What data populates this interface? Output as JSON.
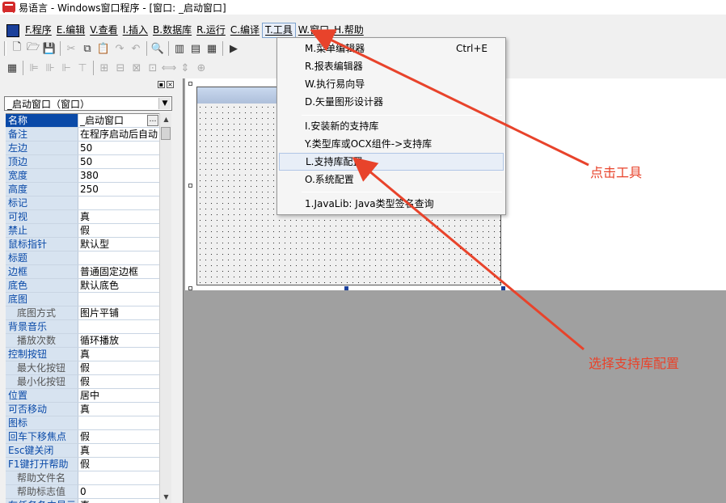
{
  "window": {
    "title": "易语言 - Windows窗口程序 - [窗口: _启动窗口]"
  },
  "menubar": {
    "items": [
      "F.程序",
      "E.编辑",
      "V.查看",
      "I.插入",
      "B.数据库",
      "R.运行",
      "C.编译",
      "T.工具",
      "W.窗口",
      "H.帮助"
    ]
  },
  "toolbar1": {
    "icons": [
      "new-icon",
      "open-icon",
      "save-icon",
      "cut-icon",
      "copy-icon",
      "paste-icon",
      "redo-icon",
      "undo-icon",
      "find-icon",
      "layout1-icon",
      "layout2-icon",
      "layout3-icon",
      "run-icon"
    ]
  },
  "toolbar2": {
    "icons": [
      "grid-icon",
      "align-left-icon",
      "align-center-icon",
      "align-right-icon",
      "align-top-icon",
      "align-middle-icon",
      "align-bottom-icon",
      "same-width-icon",
      "same-height-icon",
      "space-h-icon",
      "space-v-icon",
      "center-h-icon"
    ]
  },
  "object_selector": {
    "value": "_启动窗口（窗口）"
  },
  "properties": [
    {
      "name": "名称",
      "value": "_启动窗口",
      "selected": true
    },
    {
      "name": "备注",
      "value": "在程序启动后自动"
    },
    {
      "name": "左边",
      "value": "50"
    },
    {
      "name": "顶边",
      "value": "50"
    },
    {
      "name": "宽度",
      "value": "380"
    },
    {
      "name": "高度",
      "value": "250"
    },
    {
      "name": "标记",
      "value": ""
    },
    {
      "name": "可视",
      "value": "真"
    },
    {
      "name": "禁止",
      "value": "假"
    },
    {
      "name": "鼠标指针",
      "value": "默认型"
    },
    {
      "name": "标题",
      "value": ""
    },
    {
      "name": "边框",
      "value": "普通固定边框"
    },
    {
      "name": "底色",
      "value": "默认底色"
    },
    {
      "name": "底图",
      "value": ""
    },
    {
      "name": "底图方式",
      "value": "图片平铺",
      "sub": true
    },
    {
      "name": "背景音乐",
      "value": ""
    },
    {
      "name": "播放次数",
      "value": "循环播放",
      "sub": true
    },
    {
      "name": "控制按钮",
      "value": "真"
    },
    {
      "name": "最大化按钮",
      "value": "假",
      "sub": true
    },
    {
      "name": "最小化按钮",
      "value": "假",
      "sub": true
    },
    {
      "name": "位置",
      "value": "居中"
    },
    {
      "name": "可否移动",
      "value": "真"
    },
    {
      "name": "图标",
      "value": ""
    },
    {
      "name": "回车下移焦点",
      "value": "假"
    },
    {
      "name": "Esc键关闭",
      "value": "真"
    },
    {
      "name": "F1键打开帮助",
      "value": "假"
    },
    {
      "name": "帮助文件名",
      "value": "",
      "sub": true
    },
    {
      "name": "帮助标志值",
      "value": "0",
      "sub": true
    },
    {
      "name": "在任务条中显示",
      "value": "真"
    }
  ],
  "tools_menu": {
    "items": [
      {
        "label": "M.菜单编辑器",
        "shortcut": "Ctrl+E"
      },
      {
        "label": "R.报表编辑器",
        "shortcut": ""
      },
      {
        "label": "W.执行易向导",
        "shortcut": ""
      },
      {
        "label": "D.矢量图形设计器",
        "shortcut": ""
      },
      {
        "label": "I.安装新的支持库",
        "shortcut": ""
      },
      {
        "label": "Y.类型库或OCX组件->支持库",
        "shortcut": ""
      },
      {
        "label": "L.支持库配置",
        "shortcut": "",
        "highlighted": true
      },
      {
        "label": "O.系统配置",
        "shortcut": ""
      },
      {
        "label": "1.JavaLib: Java类型签名查询",
        "shortcut": ""
      }
    ]
  },
  "annotations": {
    "tools": "点击工具",
    "config": "选择支持库配置",
    "color": "#e8432b"
  }
}
